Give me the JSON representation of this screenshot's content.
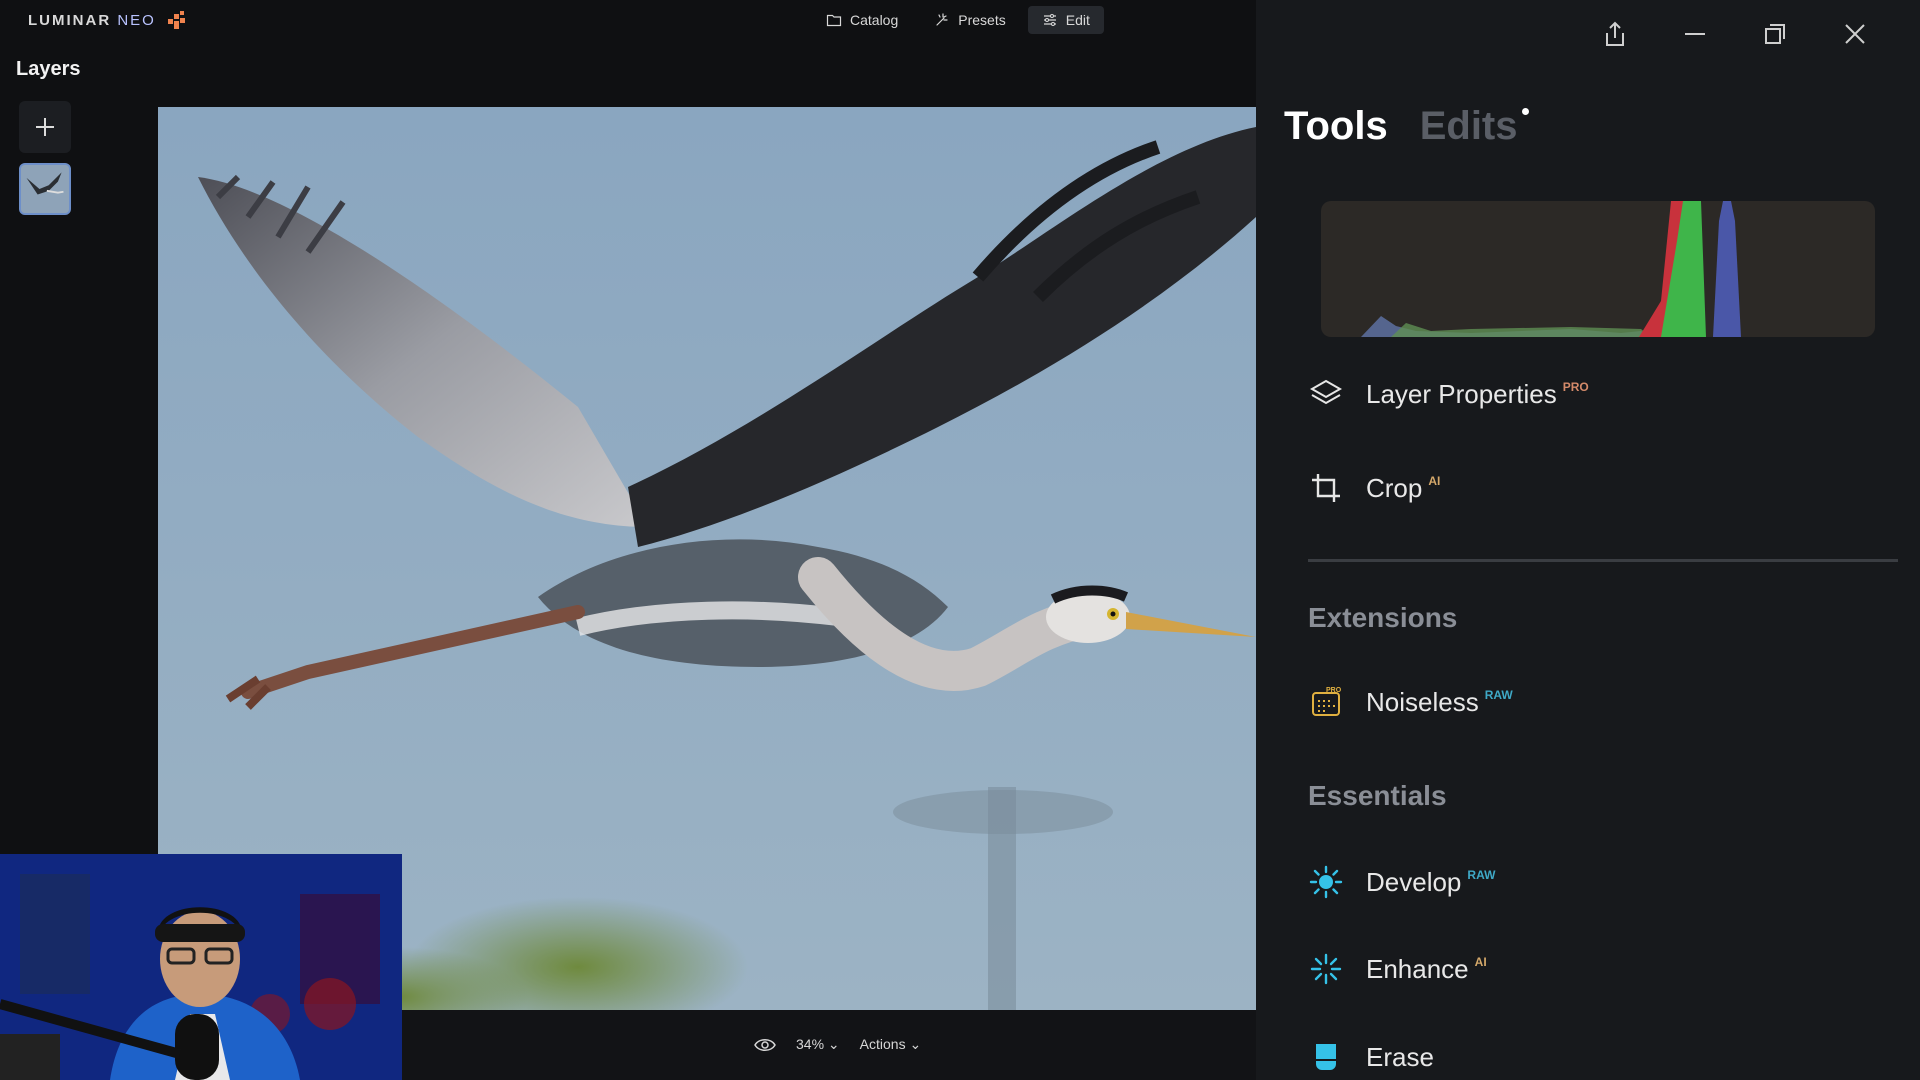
{
  "app": {
    "logo_text": "LUMINAR",
    "logo_text_2": "NEO"
  },
  "nav": [
    {
      "label": "Catalog",
      "icon": "folder-icon"
    },
    {
      "label": "Presets",
      "icon": "sparkle-icon"
    },
    {
      "label": "Edit",
      "icon": "sliders-icon",
      "active": true
    }
  ],
  "layers": {
    "title": "Layers"
  },
  "bottom_bar": {
    "zoom": "34%",
    "actions_label": "Actions"
  },
  "right_panel": {
    "tabs": [
      {
        "label": "Tools",
        "active": true
      },
      {
        "label": "Edits",
        "active": false
      }
    ],
    "tools": [
      {
        "label": "Layer Properties",
        "badge": "PRO",
        "icon": "layers-icon"
      },
      {
        "label": "Crop",
        "badge": "AI",
        "icon": "crop-icon"
      }
    ],
    "sections": [
      {
        "title": "Extensions",
        "items": [
          {
            "label": "Noiseless",
            "badge": "RAW",
            "icon": "noiseless-icon",
            "icon_badge": "PRO"
          }
        ]
      },
      {
        "title": "Essentials",
        "items": [
          {
            "label": "Develop",
            "badge": "RAW",
            "icon": "sun-icon"
          },
          {
            "label": "Enhance",
            "badge": "AI",
            "icon": "enhance-icon"
          },
          {
            "label": "Erase",
            "badge": "",
            "icon": "erase-icon"
          }
        ]
      }
    ]
  },
  "colors": {
    "accent_blue": "#6d8fc9",
    "raw_badge": "#3fa9c7",
    "ai_badge": "#d4a86a",
    "pro_badge": "#d48a6a",
    "panel_bg": "#17191c"
  }
}
